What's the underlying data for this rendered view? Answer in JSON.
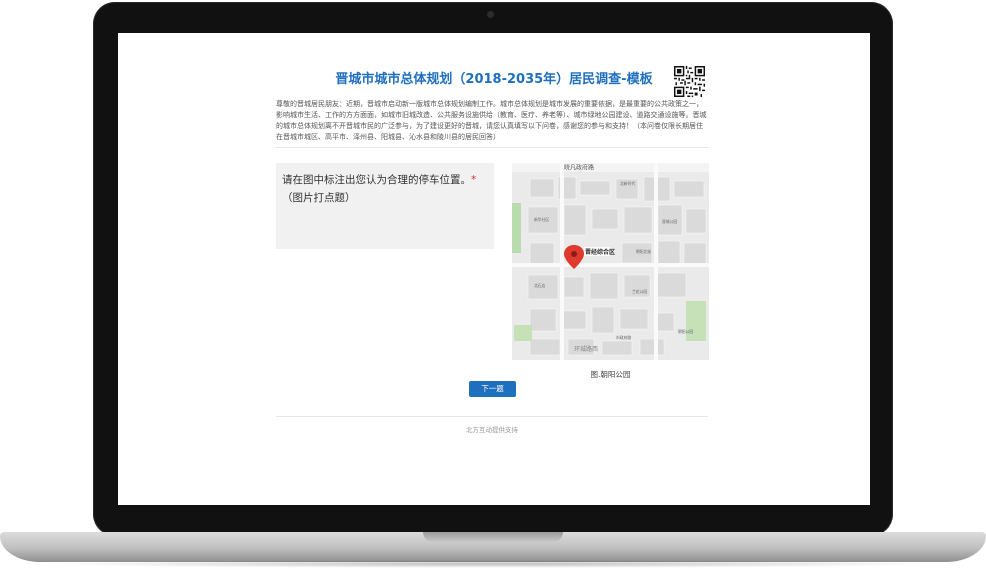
{
  "survey": {
    "title": "晋城市城市总体规划（2018-2035年）居民调查-模板",
    "intro": "尊敬的晋城居民朋友：近期，晋城市启动新一版城市总体规划编制工作。城市总体规划是城市发展的重要依据，是最重要的公共政策之一，影响城市生活、工作的方方面面，如城市旧城改造、公共服务设施供给（教育、医疗、养老等）、城市绿地公园建设、道路交通设施等。晋城的城市总体规划离不开晋城市民的广泛参与，为了建设更好的晋城，请您认真填写以下问卷，感谢您的参与和支持！（本问卷仅限长期居住在晋城市城区、高平市、泽州县、阳城县、沁水县和陵川县的居民回答）",
    "question": {
      "text": "请在图中标注出您认为合理的停车位置。",
      "required_mark": "*",
      "type_hint": "（图片打点题）"
    },
    "map": {
      "caption": "图.朝阳公园",
      "top_road_label": "晓凡政府路",
      "marker_label": "晋经综合区",
      "road_label_bottom": "环城路西",
      "place_labels": [
        "北新时代",
        "新华社区",
        "朝阳北街",
        "晋城公园",
        "兰花公园",
        "朝阳公园",
        "北石店",
        "市政府路"
      ]
    },
    "next_button_label": "下一题",
    "footer": "北方互动提供支持"
  },
  "colors": {
    "accent": "#1f6fbf",
    "required": "#e03030",
    "question_bg": "#f1f1f1"
  }
}
